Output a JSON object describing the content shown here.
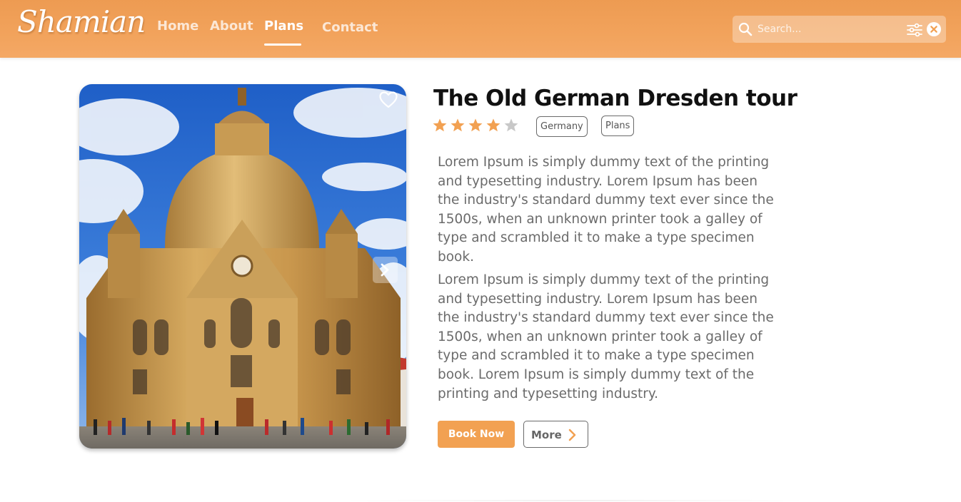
{
  "header": {
    "logo": "Shamian",
    "nav": [
      {
        "label": "Home"
      },
      {
        "label": "About"
      },
      {
        "label": "Plans"
      },
      {
        "label": "Contact"
      }
    ],
    "active_nav": "Plans",
    "search": {
      "placeholder": "Search..."
    }
  },
  "tour": {
    "title": "The Old German Dresden tour",
    "rating": 4,
    "rating_max": 5,
    "tags": [
      "Germany",
      "Plans"
    ],
    "paragraphs": [
      "Lorem Ipsum is simply dummy text of the printing and typesetting industry. Lorem Ipsum has been the industry's standard dummy text ever since the 1500s, when an unknown printer took a galley of type and scrambled it to make a type specimen book.",
      "Lorem Ipsum is simply dummy text of the printing and typesetting industry. Lorem Ipsum has been the industry's standard dummy text ever since the 1500s, when an unknown printer took a galley of type and scrambled it to make a type specimen book. Lorem Ipsum is simply dummy text of the printing and typesetting industry."
    ],
    "book_label": "Book Now",
    "more_label": "More"
  },
  "icons": {
    "search": "search-icon",
    "filter": "filter-icon",
    "clear": "close-circle-icon",
    "favorite": "heart-icon",
    "next": "chevron-right-icon",
    "star": "star-icon"
  },
  "colors": {
    "accent": "#f2a152",
    "header_bg": "#ef9e56",
    "star_filled": "#f2a152",
    "star_empty": "#c8c8c8",
    "text_muted": "#6b6b6b"
  }
}
